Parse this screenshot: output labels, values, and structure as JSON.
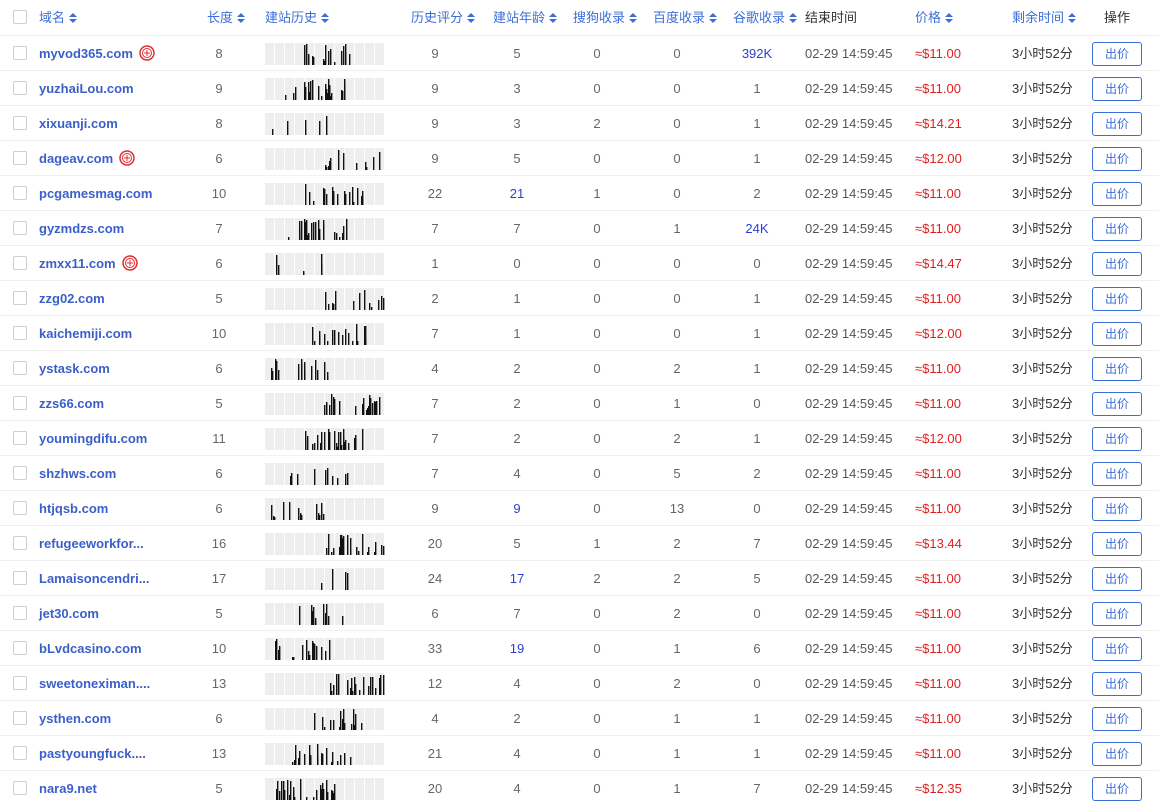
{
  "header": {
    "domain": "域名",
    "length": "长度",
    "history": "建站历史",
    "score": "历史评分",
    "age": "建站年龄",
    "sogou": "搜狗收录",
    "baidu": "百度收录",
    "google": "谷歌收录",
    "end": "结束时间",
    "price": "价格",
    "remain": "剩余时间",
    "action": "操作"
  },
  "icons": {
    "sort": "sort-icon",
    "seal": "red-seal-icon",
    "checkbox": "checkbox-icon"
  },
  "colors": {
    "link": "#3b5fc9",
    "accent": "#3b6fd8",
    "price": "#e02020",
    "highlight": "#2b3fd0"
  },
  "rows": [
    {
      "domain": "myvod365.com",
      "seal": true,
      "length": "8",
      "score": "9",
      "age": "5",
      "sogou": "0",
      "baidu": "0",
      "google": "392K",
      "end": "02-29 14:59:45",
      "price": "≈$11.00",
      "remain": "3小时52分",
      "action": "出价",
      "hist": "s1"
    },
    {
      "domain": "yuzhaiLou.com",
      "seal": false,
      "length": "9",
      "score": "9",
      "age": "3",
      "sogou": "0",
      "baidu": "0",
      "google": "1",
      "end": "02-29 14:59:45",
      "price": "≈$11.00",
      "remain": "3小时52分",
      "action": "出价",
      "hist": "s2"
    },
    {
      "domain": "xixuanji.com",
      "seal": false,
      "length": "8",
      "score": "9",
      "age": "3",
      "sogou": "2",
      "baidu": "0",
      "google": "1",
      "end": "02-29 14:59:45",
      "price": "≈$14.21",
      "remain": "3小时52分",
      "action": "出价",
      "hist": "s3"
    },
    {
      "domain": "dageav.com",
      "seal": true,
      "length": "6",
      "score": "9",
      "age": "5",
      "sogou": "0",
      "baidu": "0",
      "google": "1",
      "end": "02-29 14:59:45",
      "price": "≈$12.00",
      "remain": "3小时52分",
      "action": "出价",
      "hist": "s4"
    },
    {
      "domain": "pcgamesmag.com",
      "seal": false,
      "length": "10",
      "score": "22",
      "age": "21",
      "sogou": "1",
      "baidu": "0",
      "google": "2",
      "end": "02-29 14:59:45",
      "price": "≈$11.00",
      "remain": "3小时52分",
      "action": "出价",
      "hist": "s5"
    },
    {
      "domain": "gyzmdzs.com",
      "seal": false,
      "length": "7",
      "score": "7",
      "age": "7",
      "sogou": "0",
      "baidu": "1",
      "google": "24K",
      "end": "02-29 14:59:45",
      "price": "≈$11.00",
      "remain": "3小时52分",
      "action": "出价",
      "hist": "s6"
    },
    {
      "domain": "zmxx11.com",
      "seal": true,
      "length": "6",
      "score": "1",
      "age": "0",
      "sogou": "0",
      "baidu": "0",
      "google": "0",
      "end": "02-29 14:59:45",
      "price": "≈$14.47",
      "remain": "3小时52分",
      "action": "出价",
      "hist": "s7"
    },
    {
      "domain": "zzg02.com",
      "seal": false,
      "length": "5",
      "score": "2",
      "age": "1",
      "sogou": "0",
      "baidu": "0",
      "google": "1",
      "end": "02-29 14:59:45",
      "price": "≈$11.00",
      "remain": "3小时52分",
      "action": "出价",
      "hist": "s8"
    },
    {
      "domain": "kaichemiji.com",
      "seal": false,
      "length": "10",
      "score": "7",
      "age": "1",
      "sogou": "0",
      "baidu": "0",
      "google": "1",
      "end": "02-29 14:59:45",
      "price": "≈$12.00",
      "remain": "3小时52分",
      "action": "出价",
      "hist": "s9"
    },
    {
      "domain": "ystask.com",
      "seal": false,
      "length": "6",
      "score": "4",
      "age": "2",
      "sogou": "0",
      "baidu": "2",
      "google": "1",
      "end": "02-29 14:59:45",
      "price": "≈$11.00",
      "remain": "3小时52分",
      "action": "出价",
      "hist": "s10"
    },
    {
      "domain": "zzs66.com",
      "seal": false,
      "length": "5",
      "score": "7",
      "age": "2",
      "sogou": "0",
      "baidu": "1",
      "google": "0",
      "end": "02-29 14:59:45",
      "price": "≈$11.00",
      "remain": "3小时52分",
      "action": "出价",
      "hist": "s11"
    },
    {
      "domain": "youmingdifu.com",
      "seal": false,
      "length": "11",
      "score": "7",
      "age": "2",
      "sogou": "0",
      "baidu": "2",
      "google": "1",
      "end": "02-29 14:59:45",
      "price": "≈$12.00",
      "remain": "3小时52分",
      "action": "出价",
      "hist": "s12"
    },
    {
      "domain": "shzhws.com",
      "seal": false,
      "length": "6",
      "score": "7",
      "age": "4",
      "sogou": "0",
      "baidu": "5",
      "google": "2",
      "end": "02-29 14:59:45",
      "price": "≈$11.00",
      "remain": "3小时52分",
      "action": "出价",
      "hist": "s13"
    },
    {
      "domain": "htjqsb.com",
      "seal": false,
      "length": "6",
      "score": "9",
      "age": "9",
      "sogou": "0",
      "baidu": "13",
      "google": "0",
      "end": "02-29 14:59:45",
      "price": "≈$11.00",
      "remain": "3小时52分",
      "action": "出价",
      "hist": "s14"
    },
    {
      "domain": "refugeeworkfor...",
      "seal": false,
      "length": "16",
      "score": "20",
      "age": "5",
      "sogou": "1",
      "baidu": "2",
      "google": "7",
      "end": "02-29 14:59:45",
      "price": "≈$13.44",
      "remain": "3小时52分",
      "action": "出价",
      "hist": "s15"
    },
    {
      "domain": "Lamaisoncendri...",
      "seal": false,
      "length": "17",
      "score": "24",
      "age": "17",
      "sogou": "2",
      "baidu": "2",
      "google": "5",
      "end": "02-29 14:59:45",
      "price": "≈$11.00",
      "remain": "3小时52分",
      "action": "出价",
      "hist": "s16"
    },
    {
      "domain": "jet30.com",
      "seal": false,
      "length": "5",
      "score": "6",
      "age": "7",
      "sogou": "0",
      "baidu": "2",
      "google": "0",
      "end": "02-29 14:59:45",
      "price": "≈$11.00",
      "remain": "3小时52分",
      "action": "出价",
      "hist": "s17"
    },
    {
      "domain": "bLvdcasino.com",
      "seal": false,
      "length": "10",
      "score": "33",
      "age": "19",
      "sogou": "0",
      "baidu": "1",
      "google": "6",
      "end": "02-29 14:59:45",
      "price": "≈$11.00",
      "remain": "3小时52分",
      "action": "出价",
      "hist": "s18"
    },
    {
      "domain": "sweetoneximan....",
      "seal": false,
      "length": "13",
      "score": "12",
      "age": "4",
      "sogou": "0",
      "baidu": "2",
      "google": "0",
      "end": "02-29 14:59:45",
      "price": "≈$11.00",
      "remain": "3小时52分",
      "action": "出价",
      "hist": "s19"
    },
    {
      "domain": "ysthen.com",
      "seal": false,
      "length": "6",
      "score": "4",
      "age": "2",
      "sogou": "0",
      "baidu": "1",
      "google": "1",
      "end": "02-29 14:59:45",
      "price": "≈$11.00",
      "remain": "3小时52分",
      "action": "出价",
      "hist": "s20"
    },
    {
      "domain": "pastyoungfuck....",
      "seal": false,
      "length": "13",
      "score": "21",
      "age": "4",
      "sogou": "0",
      "baidu": "1",
      "google": "1",
      "end": "02-29 14:59:45",
      "price": "≈$11.00",
      "remain": "3小时52分",
      "action": "出价",
      "hist": "s21"
    },
    {
      "domain": "nara9.net",
      "seal": false,
      "length": "5",
      "score": "20",
      "age": "4",
      "sogou": "0",
      "baidu": "1",
      "google": "7",
      "end": "02-29 14:59:45",
      "price": "≈$12.35",
      "remain": "3小时52分",
      "action": "出价",
      "hist": "s22"
    }
  ]
}
